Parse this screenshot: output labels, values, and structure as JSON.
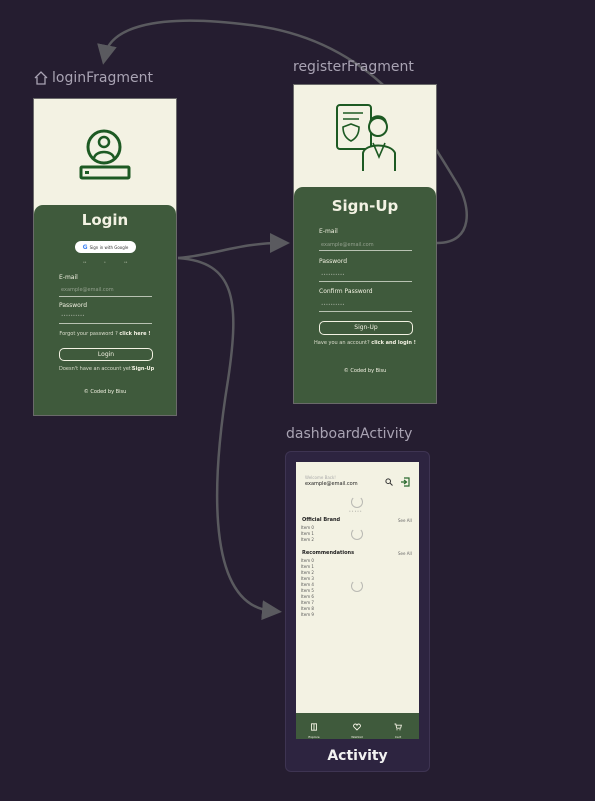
{
  "destinations": {
    "login": {
      "label": "loginFragment",
      "title": "Login",
      "google_button": "Sign in with Google",
      "divider_dots": [
        "••",
        "•",
        "••"
      ],
      "email_label": "E-mail",
      "email_placeholder": "example@email.com",
      "password_label": "Password",
      "password_placeholder": "••••••••••",
      "forgot_text": "Forgot your password ?",
      "forgot_link": "click here !",
      "login_button": "Login",
      "no_account_text": "Doesn't have an account yet?",
      "signup_link": "Sign-Up",
      "footer": "© Coded by Bisu"
    },
    "register": {
      "label": "registerFragment",
      "title": "Sign-Up",
      "email_label": "E-mail",
      "email_placeholder": "example@email.com",
      "password_label": "Password",
      "password_placeholder": "••••••••••",
      "confirm_label": "Confirm Password",
      "confirm_placeholder": "••••••••••",
      "signup_button": "Sign-Up",
      "have_account_text": "Have you an account?",
      "login_link": "click and login !",
      "footer": "© Coded by Bisu"
    },
    "dashboard": {
      "label": "dashboardActivity",
      "caption": "Activity",
      "welcome": "Welcome Back!",
      "email": "example@email.com",
      "dots": "• • • • •",
      "official_title": "Official Brand",
      "see_all_1": "See All",
      "official_items": [
        "Item 0",
        "Item 1",
        "Item 2"
      ],
      "recommend_title": "Recommendations",
      "see_all_2": "See All",
      "recommend_items": [
        "Item 0",
        "Item 1",
        "Item 2",
        "Item 3",
        "Item 4",
        "Item 5",
        "Item 6",
        "Item 7",
        "Item 8",
        "Item 9"
      ],
      "nav": [
        "Explore",
        "Wishlist",
        "Cart"
      ]
    }
  },
  "colors": {
    "canvas": "#251d30",
    "screen_cream": "#f3f2e3",
    "screen_green": "#3f5a3c",
    "icon_green": "#1d5a23",
    "arrow": "#5a5a5f"
  },
  "icons": [
    "home-icon",
    "user-account-icon",
    "profile-illustration",
    "search-icon",
    "logout-icon",
    "explore-icon",
    "wishlist-icon",
    "cart-icon"
  ]
}
